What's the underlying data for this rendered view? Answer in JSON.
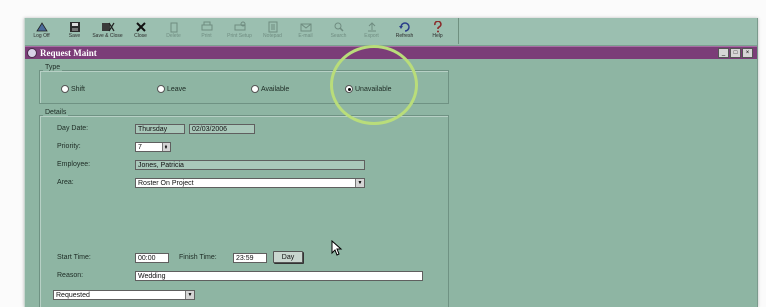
{
  "toolbar": {
    "buttons": [
      {
        "label": "Log Off",
        "icon": "log-off-icon",
        "enabled": true
      },
      {
        "label": "Save",
        "icon": "save-icon",
        "enabled": true
      },
      {
        "label": "Save & Close",
        "icon": "save-close-icon",
        "enabled": true
      },
      {
        "label": "Close",
        "icon": "close-icon",
        "enabled": true
      },
      {
        "label": "Delete",
        "icon": "delete-icon",
        "enabled": false
      },
      {
        "label": "Print",
        "icon": "print-icon",
        "enabled": false
      },
      {
        "label": "Print Setup",
        "icon": "print-setup-icon",
        "enabled": false
      },
      {
        "label": "Notepad",
        "icon": "notepad-icon",
        "enabled": false
      },
      {
        "label": "E-mail",
        "icon": "email-icon",
        "enabled": false
      },
      {
        "label": "Search",
        "icon": "search-icon",
        "enabled": false
      },
      {
        "label": "Export",
        "icon": "export-icon",
        "enabled": false
      },
      {
        "label": "Refresh",
        "icon": "refresh-icon",
        "enabled": true
      },
      {
        "label": "Help",
        "icon": "help-icon",
        "enabled": true
      }
    ]
  },
  "window": {
    "title": "Request Maint",
    "controls": [
      "_",
      "□",
      "×"
    ],
    "title_bar_color": "#7b3d78",
    "background_color": "#8eb5a3"
  },
  "type_group": {
    "title": "Type",
    "options": [
      "Shift",
      "Leave",
      "Available",
      "Unavailable"
    ],
    "selected": "Unavailable"
  },
  "details": {
    "title": "Details",
    "day_date_label": "Day Date:",
    "day_value": "Thursday",
    "date_value": "02/03/2006",
    "priority_label": "Priority:",
    "priority_value": "7",
    "employee_label": "Employee:",
    "employee_value": "Jones, Patricia",
    "area_label": "Area:",
    "area_value": "Roster On Project",
    "start_time_label": "Start Time:",
    "start_time_value": "00:00",
    "finish_time_label": "Finish Time:",
    "finish_time_value": "23:59",
    "day_button": "Day",
    "reason_label": "Reason:",
    "reason_value": "Wedding",
    "status_value": "Requested"
  },
  "highlight_color": "#b9dd7a"
}
